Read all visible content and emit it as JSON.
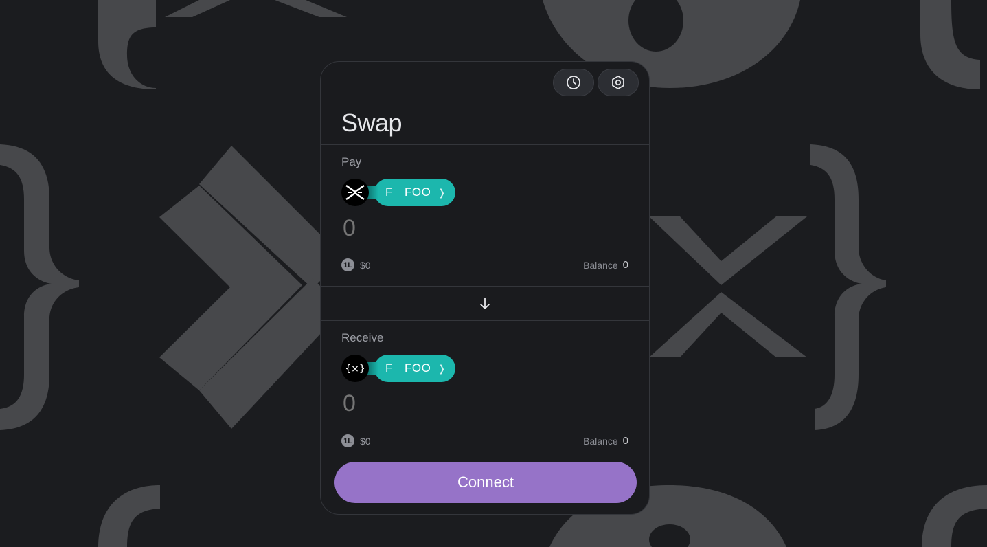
{
  "swap": {
    "title": "Swap",
    "history_icon": "clock-icon",
    "settings_icon": "gear-icon"
  },
  "pay": {
    "label": "Pay",
    "token_letter": "F",
    "token_symbol": "FOO",
    "chevron": "❭",
    "amount_placeholder": "0",
    "usd_value": "$0",
    "balance_label": "Balance",
    "balance_value": "0"
  },
  "receive": {
    "label": "Receive",
    "token_letter": "F",
    "token_symbol": "FOO",
    "chevron": "❭",
    "amount_placeholder": "0",
    "usd_value": "$0",
    "balance_label": "Balance",
    "balance_value": "0"
  },
  "connect_label": "Connect",
  "colors": {
    "accent": "#9673c8",
    "token_chip": "#1cb7ad",
    "background": "#1b1c1f"
  }
}
